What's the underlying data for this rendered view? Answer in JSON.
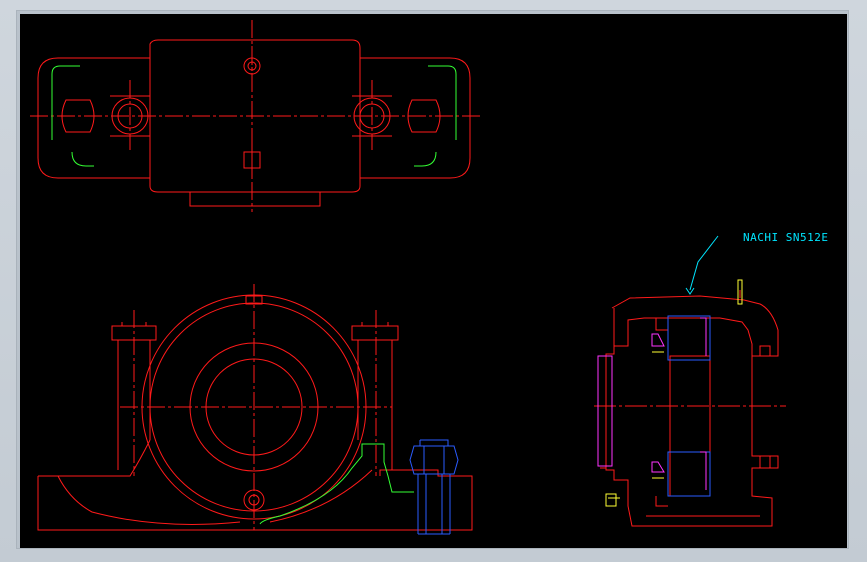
{
  "drawing": {
    "part_label": "NACHI SN512E",
    "colors": {
      "background": "#000000",
      "outline": "#ff1a1a",
      "green": "#33ff33",
      "blue": "#2a5cff",
      "magenta": "#ff33ff",
      "yellow": "#ffff33",
      "cyan_label": "#00e5ff"
    }
  }
}
